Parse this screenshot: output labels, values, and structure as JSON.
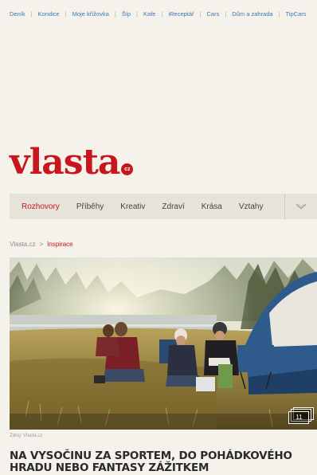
{
  "top_links": [
    "Deník",
    "Kondice",
    "Moje křížovka",
    "Šíp",
    "Kafe",
    "iReceptář",
    "Cars",
    "Dům a zahrada",
    "TipCars"
  ],
  "logo": {
    "text": "vlasta",
    "badge": "cz"
  },
  "nav": {
    "items": [
      "Rozhovory",
      "Příběhy",
      "Kreativ",
      "Zdraví",
      "Krása",
      "Vztahy"
    ],
    "active": "Rozhovory",
    "more_icon": "chevron-down-icon"
  },
  "breadcrumb": {
    "home": "Vlasta.cz",
    "separator": ">",
    "current": "Inspirace"
  },
  "hero": {
    "gallery_count": "11",
    "gallery_icon": "gallery-stack-icon"
  },
  "source": "Zdroj: Vlasta.cz",
  "headline": "NA VYSOČINU ZA SPORTEM, DO POHÁDKOVÉHO HRADU NEBO FANTASY ZÁŽITKEM",
  "colors": {
    "brand": "#c8161d",
    "link": "#3f78b5",
    "background": "#f4f2ea",
    "nav_bg": "#e6e3d9"
  }
}
